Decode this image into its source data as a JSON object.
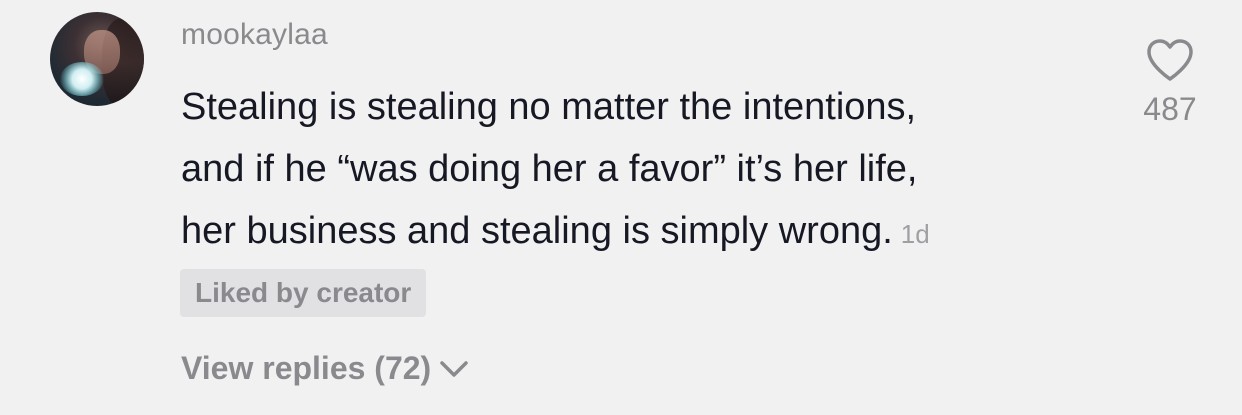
{
  "comment": {
    "username": "mookaylaa",
    "text_lines": [
      "Stealing is stealing no matter the intentions,",
      "and if he “was doing her a favor” it’s her life,",
      "her business and stealing is simply wrong."
    ],
    "timestamp": "1d",
    "liked_badge": "Liked by creator",
    "view_replies": "View replies (72)",
    "like_count": "487",
    "icons": {
      "like": "heart-icon",
      "expand": "chevron-down-icon"
    }
  },
  "colors": {
    "background": "#f1f1f2",
    "text": "#161823",
    "muted": "#8a8a8e",
    "badge_bg": "#e1e1e3"
  }
}
